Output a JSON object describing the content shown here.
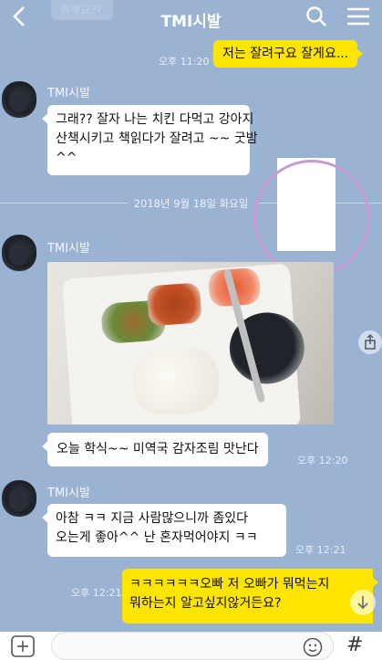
{
  "header": {
    "title": "TMI시발",
    "faded_prev_text": "뭐해요??"
  },
  "messages": {
    "m1": {
      "text": "저는 잘려구요 잘게요...",
      "time": "오후 11:20"
    },
    "m2": {
      "sender": "TMI시발",
      "lines": [
        "그래?? 잘자 나는 치킨 다먹고 강아지",
        "산책시키고 책읽다가 잘려고 ~~ 굿밤",
        "^^"
      ]
    },
    "date_divider": "2018년 9월 18일 화요일",
    "m3": {
      "sender": "TMI시발",
      "text": "오늘 학식~~ 미역국 감자조림 맛난다",
      "time": "오후 12:20"
    },
    "m4": {
      "sender": "TMI시발",
      "lines": [
        "아참 ㅋㅋ 지금 사람많으니까 좀있다",
        "오는게 좋아^^ 난 혼자먹어야지 ㅋㅋ"
      ],
      "time": "오후 12:21"
    },
    "m5": {
      "lines": [
        "ㅋㅋㅋㅋㅋㅋ오빠 저 오빠가 뭐먹는지",
        "뭐하는지 알고싶지않거든요?"
      ],
      "time": "오후 12:21"
    }
  },
  "input": {
    "hash_label": "#"
  },
  "colors": {
    "background": "#9bb3d3",
    "my_bubble": "#fee500",
    "their_bubble": "#ffffff",
    "highlight_circle": "#c79ad7"
  },
  "icons": [
    "back-arrow-icon",
    "search-icon",
    "hamburger-menu-icon",
    "share-icon",
    "scroll-down-icon",
    "plus-icon",
    "emoji-icon",
    "hash-icon"
  ]
}
